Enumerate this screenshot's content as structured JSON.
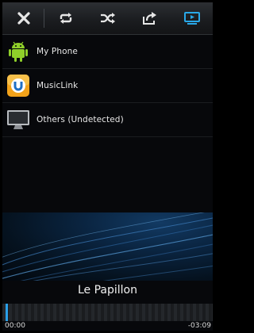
{
  "toolbar": {
    "buttons": [
      {
        "icon": "close-icon"
      },
      {
        "icon": "repeat-icon"
      },
      {
        "icon": "shuffle-icon"
      },
      {
        "icon": "share-icon"
      },
      {
        "icon": "play-to-screen-icon",
        "active": true
      }
    ],
    "accent": "#29a8e8"
  },
  "devices": [
    {
      "label": "My Phone",
      "icon": "android-icon"
    },
    {
      "label": "MusicLink",
      "icon": "musiclink-icon"
    },
    {
      "label": "Others (Undetected)",
      "icon": "monitor-icon"
    }
  ],
  "player": {
    "track_title": "Le Papillon",
    "elapsed": "00:00",
    "remaining": "-03:09",
    "progress": 0.0
  }
}
